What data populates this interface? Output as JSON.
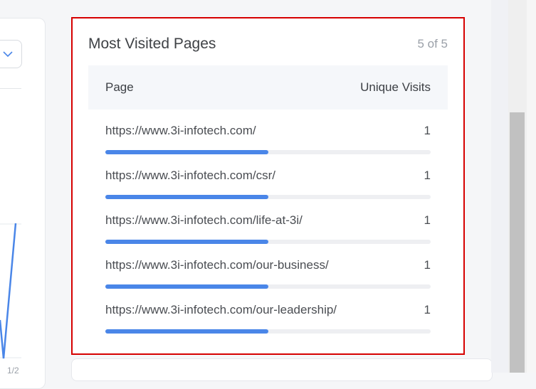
{
  "widget": {
    "title": "Most Visited Pages",
    "count_label": "5 of 5",
    "columns": {
      "page": "Page",
      "visits": "Unique Visits"
    },
    "rows": [
      {
        "url": "https://www.3i-infotech.com/",
        "visits": "1",
        "bar_fraction": 0.5
      },
      {
        "url": "https://www.3i-infotech.com/csr/",
        "visits": "1",
        "bar_fraction": 0.5
      },
      {
        "url": "https://www.3i-infotech.com/life-at-3i/",
        "visits": "1",
        "bar_fraction": 0.5
      },
      {
        "url": "https://www.3i-infotech.com/our-business/",
        "visits": "1",
        "bar_fraction": 0.5
      },
      {
        "url": "https://www.3i-infotech.com/our-leadership/",
        "visits": "1",
        "bar_fraction": 0.5
      }
    ]
  },
  "colors": {
    "bar": "#4a86e8",
    "highlight_border": "#d60000",
    "track": "#eeeff2"
  },
  "left_panel": {
    "dropdown_icon": "chevron-down-icon",
    "axis_label": "1/2"
  }
}
